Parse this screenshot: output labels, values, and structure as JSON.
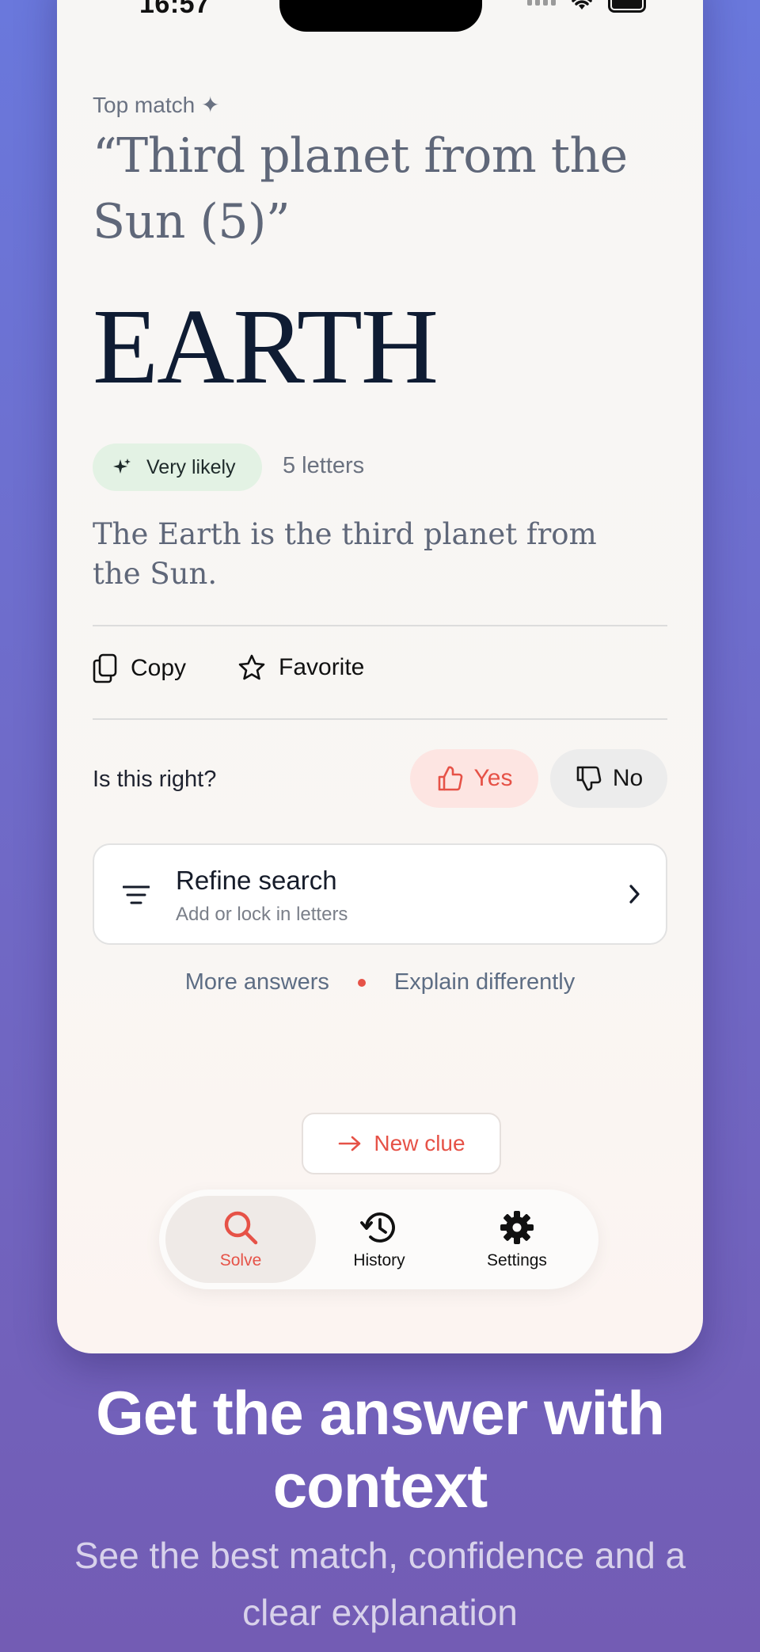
{
  "status_bar": {
    "time": "16:57"
  },
  "result": {
    "eyebrow": "Top match ✦",
    "clue": "“Third planet from the Sun (5)”",
    "answer": "EARTH",
    "confidence": "Very likely",
    "letter_count": "5 letters",
    "explanation": "The Earth is the third planet from the Sun."
  },
  "actions": {
    "copy": "Copy",
    "favorite": "Favorite"
  },
  "feedback": {
    "question": "Is this right?",
    "yes": "Yes",
    "no": "No"
  },
  "refine": {
    "title": "Refine search",
    "subtitle": "Add or lock in letters"
  },
  "links": {
    "more": "More answers",
    "explain": "Explain differently"
  },
  "new_clue": "New clue",
  "tabs": [
    {
      "label": "Solve",
      "icon": "search-icon",
      "active": true
    },
    {
      "label": "History",
      "icon": "history-icon",
      "active": false
    },
    {
      "label": "Settings",
      "icon": "gear-icon",
      "active": false
    }
  ],
  "marketing": {
    "headline": "Get the answer with context",
    "subline": "See the best match, confidence and a clear explanation"
  },
  "colors": {
    "accent": "#e65247",
    "answer": "#0f1c33",
    "pill": "#e3f2e4"
  }
}
